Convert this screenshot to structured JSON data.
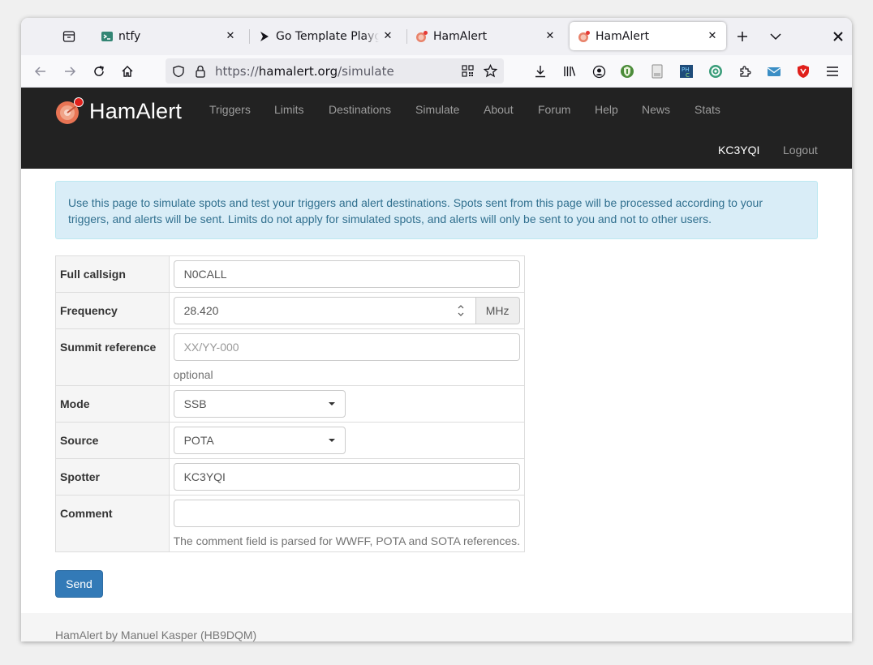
{
  "browser": {
    "tabs": [
      {
        "title": "ntfy",
        "icon": "terminal-icon"
      },
      {
        "title": "Go Template Playground",
        "icon": "play-icon"
      },
      {
        "title": "HamAlert",
        "icon": "hamalert-icon"
      },
      {
        "title": "HamAlert",
        "icon": "hamalert-icon",
        "active": true
      }
    ],
    "url": {
      "scheme": "https://",
      "host": "hamalert.org",
      "path": "/simulate"
    }
  },
  "site": {
    "logo_text": "HamAlert",
    "nav": [
      "Triggers",
      "Limits",
      "Destinations",
      "Simulate",
      "About",
      "Forum",
      "Help",
      "News",
      "Stats"
    ],
    "user": "KC3YQI",
    "logout": "Logout"
  },
  "info_text": "Use this page to simulate spots and test your triggers and alert destinations. Spots sent from this page will be processed according to your triggers, and alerts will be sent. Limits do not apply for simulated spots, and alerts will only be sent to you and not to other users.",
  "form": {
    "callsign": {
      "label": "Full callsign",
      "value": "N0CALL"
    },
    "frequency": {
      "label": "Frequency",
      "value": "28.420",
      "unit": "MHz"
    },
    "summit": {
      "label": "Summit reference",
      "placeholder": "XX/YY-000",
      "help": "optional"
    },
    "mode": {
      "label": "Mode",
      "value": "SSB"
    },
    "source": {
      "label": "Source",
      "value": "POTA"
    },
    "spotter": {
      "label": "Spotter",
      "value": "KC3YQI"
    },
    "comment": {
      "label": "Comment",
      "value": "",
      "help": "The comment field is parsed for WWFF, POTA and SOTA references."
    },
    "send_label": "Send"
  },
  "footer": "HamAlert by Manuel Kasper (HB9DQM)",
  "colors": {
    "accent": "#337ab7",
    "navbar": "#222222",
    "info_bg": "#d9edf7",
    "info_text": "#31708f"
  }
}
